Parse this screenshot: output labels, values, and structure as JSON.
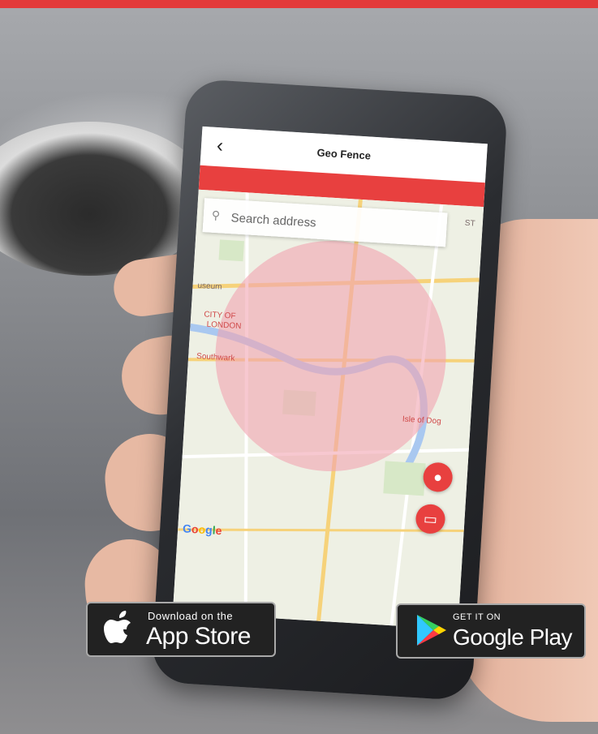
{
  "app": {
    "title": "Geo Fence",
    "back_icon": "chevron-left-icon",
    "accent": "#e8403f"
  },
  "search": {
    "placeholder": "Search address",
    "icon": "search-icon"
  },
  "map": {
    "labels": [
      "useum",
      "CITY OF",
      "LONDON",
      "Southwark",
      "Isle of Dog",
      "ST"
    ],
    "fence_color": "#f2a3b0",
    "buttons": [
      {
        "icon": "person-icon"
      },
      {
        "icon": "car-icon"
      }
    ],
    "attribution": "Google"
  },
  "badges": {
    "app_store": {
      "top": "Download on the",
      "bottom": "App Store",
      "icon": "apple-icon"
    },
    "google_play": {
      "top": "GET IT ON",
      "bottom": "Google Play",
      "icon": "play-triangle-icon"
    }
  }
}
